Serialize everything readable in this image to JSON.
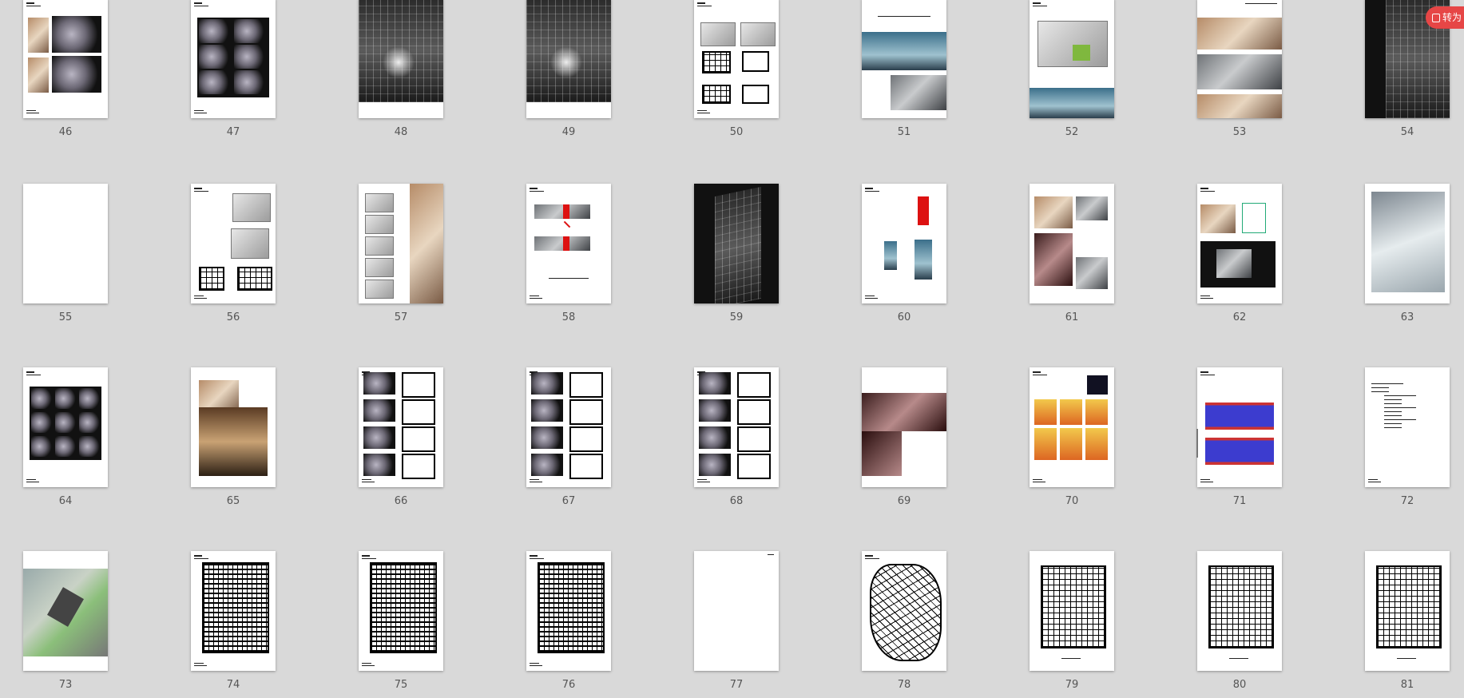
{
  "pages": [
    {
      "n": "46",
      "kind": "render-grid-dark"
    },
    {
      "n": "47",
      "kind": "render-grid-six"
    },
    {
      "n": "48",
      "kind": "tower-interior"
    },
    {
      "n": "49",
      "kind": "tower-interior"
    },
    {
      "n": "50",
      "kind": "floorplan-mix"
    },
    {
      "n": "51",
      "kind": "photo-blue"
    },
    {
      "n": "52",
      "kind": "iso-green"
    },
    {
      "n": "53",
      "kind": "collage-warm"
    },
    {
      "n": "54",
      "kind": "facade-dark"
    },
    {
      "n": "55",
      "kind": "blank"
    },
    {
      "n": "56",
      "kind": "iso-plans"
    },
    {
      "n": "57",
      "kind": "collage-column"
    },
    {
      "n": "58",
      "kind": "diagram-red"
    },
    {
      "n": "59",
      "kind": "tower-night"
    },
    {
      "n": "60",
      "kind": "diagram-tower"
    },
    {
      "n": "61",
      "kind": "collage-stairs"
    },
    {
      "n": "62",
      "kind": "collage-sketch"
    },
    {
      "n": "63",
      "kind": "atrium-photo"
    },
    {
      "n": "64",
      "kind": "render-grid-nine"
    },
    {
      "n": "65",
      "kind": "photo-hall"
    },
    {
      "n": "66",
      "kind": "renders-plans"
    },
    {
      "n": "67",
      "kind": "renders-plans"
    },
    {
      "n": "68",
      "kind": "renders-plans"
    },
    {
      "n": "69",
      "kind": "stairs-photo"
    },
    {
      "n": "70",
      "kind": "colored-models"
    },
    {
      "n": "71",
      "kind": "blue-slabs"
    },
    {
      "n": "72",
      "kind": "text-list"
    },
    {
      "n": "73",
      "kind": "site-plan"
    },
    {
      "n": "74",
      "kind": "plan-heavy"
    },
    {
      "n": "75",
      "kind": "plan-heavy"
    },
    {
      "n": "76",
      "kind": "plan-heavy"
    },
    {
      "n": "77",
      "kind": "blank-header"
    },
    {
      "n": "78",
      "kind": "plan-scribble"
    },
    {
      "n": "79",
      "kind": "plan-light"
    },
    {
      "n": "80",
      "kind": "plan-light"
    },
    {
      "n": "81",
      "kind": "plan-light"
    }
  ],
  "badge": {
    "label": "转为"
  },
  "colors": {
    "background": "#d9d9d9",
    "badge": "#e64646",
    "accent_red": "#d11111",
    "slab_blue": "#3c3ccf"
  }
}
